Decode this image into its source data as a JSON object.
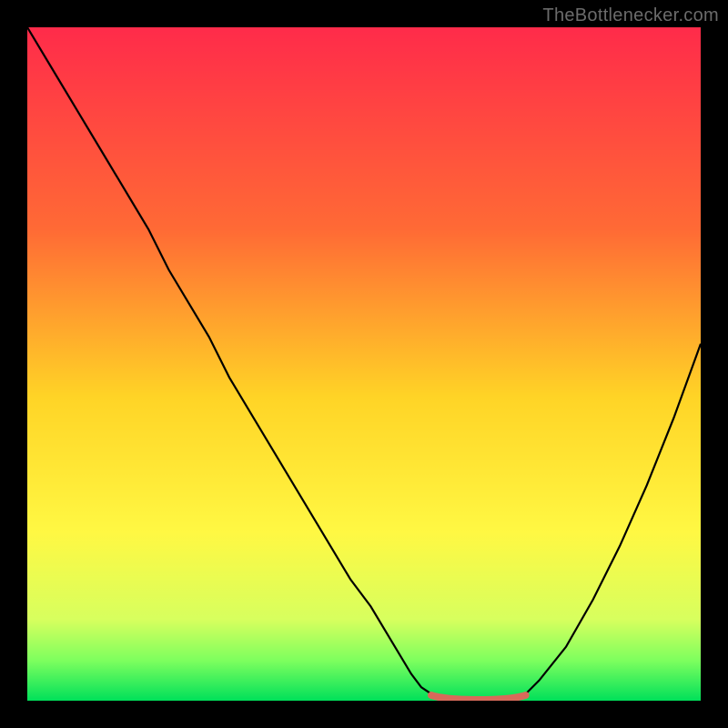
{
  "watermark": {
    "text": "TheBottlenecker.com"
  },
  "colors": {
    "bg": "#000000",
    "grad_top": "#ff2b4a",
    "grad_mid1": "#ff6a35",
    "grad_mid2": "#ffd426",
    "grad_mid3": "#fff843",
    "grad_low1": "#d7ff5e",
    "grad_low2": "#7eff5e",
    "grad_bottom": "#00e05a",
    "curve": "#000000",
    "mark": "#d86a5a"
  },
  "chart_data": {
    "type": "line",
    "title": "",
    "xlabel": "",
    "ylabel": "",
    "xlim": [
      0,
      100
    ],
    "ylim": [
      0,
      100
    ],
    "series": [
      {
        "name": "bottleneck-curve",
        "x": [
          0,
          3,
          6,
          9,
          12,
          15,
          18,
          21,
          24,
          27,
          30,
          33,
          36,
          39,
          42,
          45,
          48,
          51,
          54,
          57,
          58.5,
          60,
          62,
          64,
          66,
          68,
          70,
          72,
          74,
          76,
          80,
          84,
          88,
          92,
          96,
          100
        ],
        "y": [
          100,
          95,
          90,
          85,
          80,
          75,
          70,
          64,
          59,
          54,
          48,
          43,
          38,
          33,
          28,
          23,
          18,
          14,
          9,
          4,
          2,
          1,
          0.3,
          0,
          0,
          0,
          0,
          0.3,
          1,
          3,
          8,
          15,
          23,
          32,
          42,
          53
        ]
      }
    ],
    "marker_region": {
      "x_start": 60,
      "x_end": 74,
      "y": 0
    }
  }
}
